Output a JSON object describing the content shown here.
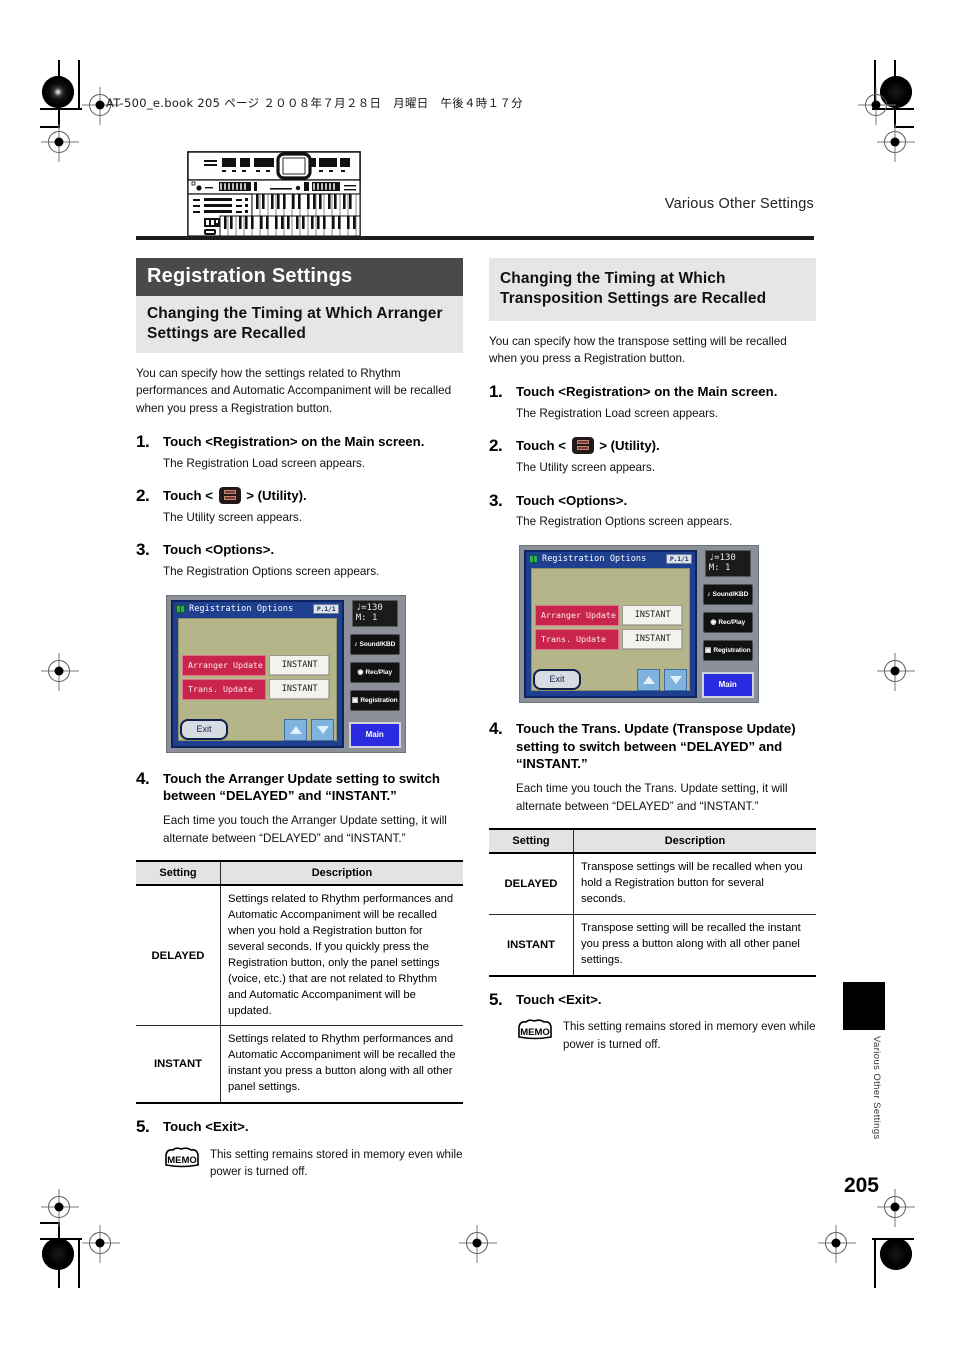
{
  "print": {
    "file_info": "AT-500_e.book  205 ページ  ２００８年７月２８日　月曜日　午後４時１７分"
  },
  "header": {
    "running_head": "Various Other Settings",
    "illustration_name": "organ-keyboard-illustration"
  },
  "left_column": {
    "chapter_title": "Registration Settings",
    "section_title": "Changing the Timing at Which Arranger Settings are Recalled",
    "intro": "You can specify how the settings related to Rhythm performances and Automatic Accompaniment will be recalled when you press a Registration button.",
    "steps": [
      {
        "num": "1.",
        "title": "Touch <Registration> on the Main screen.",
        "desc": "The Registration Load screen appears."
      },
      {
        "num": "2.",
        "title_before": "Touch < ",
        "title_after": " > (Utility).",
        "desc": "The Utility screen appears."
      },
      {
        "num": "3.",
        "title": "Touch <Options>.",
        "desc": "The Registration Options screen appears."
      },
      {
        "num": "4.",
        "title": "Touch the Arranger Update setting to switch between “DELAYED” and “INSTANT.”",
        "desc": "Each time you touch the Arranger Update setting, it will alternate between “DELAYED” and “INSTANT.”"
      },
      {
        "num": "5.",
        "title": "Touch <Exit>.",
        "desc": ""
      }
    ],
    "table": {
      "headers": [
        "Setting",
        "Description"
      ],
      "rows": [
        {
          "setting": "DELAYED",
          "description": "Settings related to Rhythm performances and Automatic Accompaniment will be recalled when you hold a Registration button for several seconds. If you quickly press the Registration button, only the panel settings (voice, etc.) that are not related to Rhythm and Automatic Accompaniment will be updated."
        },
        {
          "setting": "INSTANT",
          "description": "Settings related to Rhythm performances and Automatic Accompaniment will be recalled the instant you press a button along with all other panel settings."
        }
      ]
    },
    "memo": {
      "badge": "MEMO",
      "text": "This setting remains stored in memory even while power is turned off."
    }
  },
  "right_column": {
    "section_title": "Changing the Timing at Which Transposition Settings are Recalled",
    "intro": "You can specify how the transpose setting will be recalled when you press a Registration button.",
    "steps": [
      {
        "num": "1.",
        "title": "Touch <Registration> on the Main screen.",
        "desc": "The Registration Load screen appears."
      },
      {
        "num": "2.",
        "title_before": "Touch < ",
        "title_after": " > (Utility).",
        "desc": "The Utility screen appears."
      },
      {
        "num": "3.",
        "title": "Touch <Options>.",
        "desc": "The Registration Options screen appears."
      },
      {
        "num": "4.",
        "title": "Touch the Trans. Update (Transpose Update) setting to switch between “DELAYED” and “INSTANT.”",
        "desc": "Each time you touch the Trans. Update setting, it will alternate between “DELAYED” and “INSTANT.”"
      },
      {
        "num": "5.",
        "title": "Touch <Exit>.",
        "desc": ""
      }
    ],
    "table": {
      "headers": [
        "Setting",
        "Description"
      ],
      "rows": [
        {
          "setting": "DELAYED",
          "description": "Transpose settings will be recalled when you hold a Registration button for several seconds."
        },
        {
          "setting": "INSTANT",
          "description": "Transpose setting will be recalled the instant you press a button along with all other panel settings."
        }
      ]
    },
    "memo": {
      "badge": "MEMO",
      "text": "This setting remains stored in memory even while power is turned off."
    }
  },
  "lcd": {
    "title": "Registration Options",
    "page_indicator": "P.1/1",
    "rows": [
      {
        "label": "Arranger Update",
        "value": "INSTANT"
      },
      {
        "label": "Trans. Update",
        "value": "INSTANT"
      }
    ],
    "exit_label": "Exit",
    "tempo_line1": "♩=130",
    "tempo_line2": "M:     1",
    "side_buttons": [
      "Sound/KBD",
      "Rec/Play",
      "Registration"
    ],
    "main_button": "Main",
    "colors": {
      "bezel": "#8c9098",
      "screen_frame": "#1f3f8f",
      "screen_body": "#b4b68a",
      "label": "#c8244c",
      "value": "#f2f2ee",
      "main_button": "#2a2ae0"
    }
  },
  "footer": {
    "side_tab_label": "Various Other Settings",
    "page_number": "205"
  }
}
